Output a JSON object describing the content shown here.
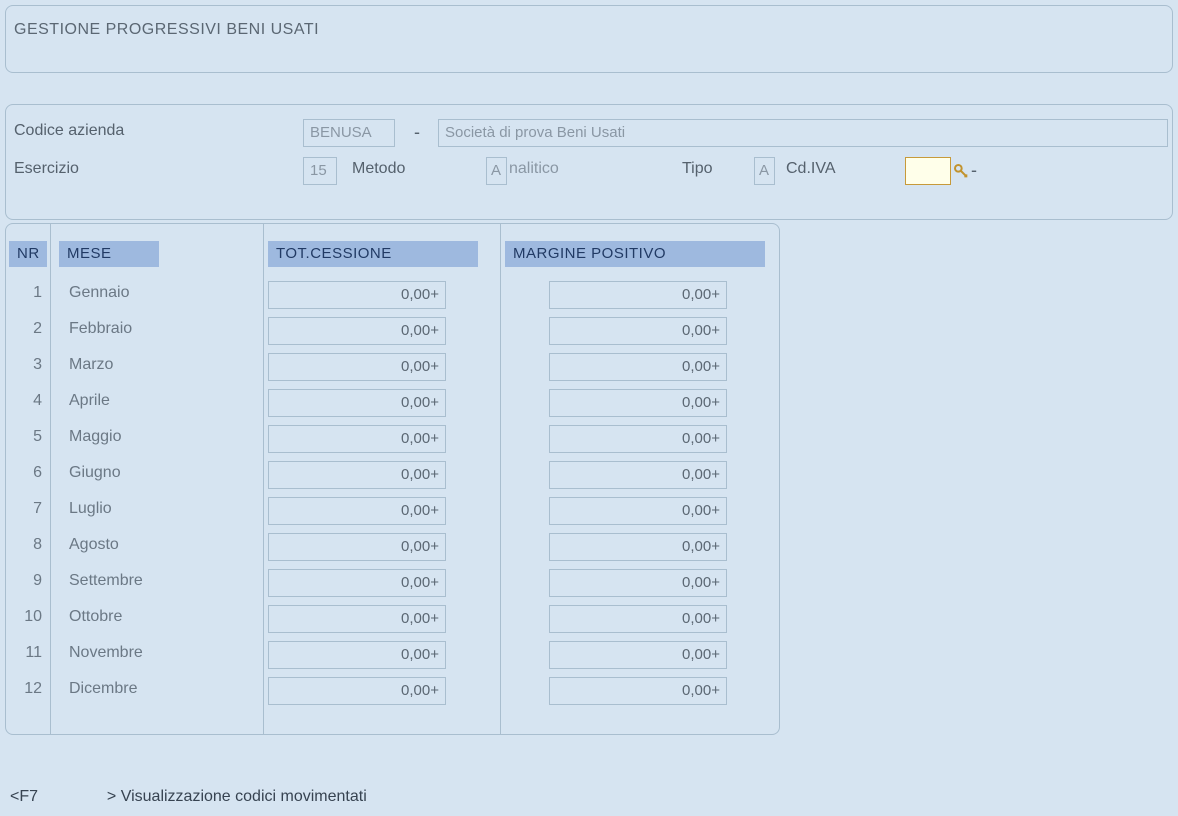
{
  "title": "GESTIONE PROGRESSIVI BENI USATI",
  "header": {
    "labels": {
      "azienda": "Codice azienda",
      "esercizio": "Esercizio",
      "metodo": "Metodo",
      "tipo": "Tipo",
      "cdiva": "Cd.IVA"
    },
    "values": {
      "azienda_cod": "BENUSA",
      "azienda_desc": "Società di prova Beni Usati",
      "esercizio": "15",
      "metodo_cod": "A",
      "metodo_desc": "nalitico",
      "tipo": "A",
      "cdiva": ""
    }
  },
  "grid": {
    "headers": {
      "nr": "NR",
      "mese": "MESE",
      "tot_cess": "TOT.CESSIONE",
      "marg_pos": "MARGINE POSITIVO"
    },
    "rows": [
      {
        "nr": "1",
        "mese": "Gennaio",
        "tot": "0,00+",
        "marg": "0,00+"
      },
      {
        "nr": "2",
        "mese": "Febbraio",
        "tot": "0,00+",
        "marg": "0,00+"
      },
      {
        "nr": "3",
        "mese": "Marzo",
        "tot": "0,00+",
        "marg": "0,00+"
      },
      {
        "nr": "4",
        "mese": "Aprile",
        "tot": "0,00+",
        "marg": "0,00+"
      },
      {
        "nr": "5",
        "mese": "Maggio",
        "tot": "0,00+",
        "marg": "0,00+"
      },
      {
        "nr": "6",
        "mese": "Giugno",
        "tot": "0,00+",
        "marg": "0,00+"
      },
      {
        "nr": "7",
        "mese": "Luglio",
        "tot": "0,00+",
        "marg": "0,00+"
      },
      {
        "nr": "8",
        "mese": "Agosto",
        "tot": "0,00+",
        "marg": "0,00+"
      },
      {
        "nr": "9",
        "mese": "Settembre",
        "tot": "0,00+",
        "marg": "0,00+"
      },
      {
        "nr": "10",
        "mese": "Ottobre",
        "tot": "0,00+",
        "marg": "0,00+"
      },
      {
        "nr": "11",
        "mese": "Novembre",
        "tot": "0,00+",
        "marg": "0,00+"
      },
      {
        "nr": "12",
        "mese": "Dicembre",
        "tot": "0,00+",
        "marg": "0,00+"
      }
    ]
  },
  "footer": {
    "key": "<F7",
    "text": "> Visualizzazione codici movimentati"
  }
}
